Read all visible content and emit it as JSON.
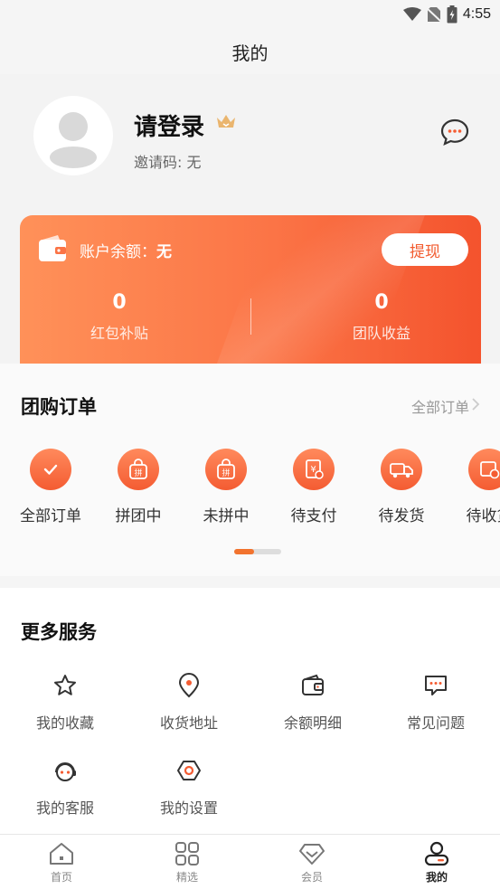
{
  "status_bar": {
    "time": "4:55"
  },
  "header": {
    "title": "我的"
  },
  "profile": {
    "name": "请登录",
    "invite_label": "邀请码: 无"
  },
  "balance": {
    "label": "账户余额：",
    "value": "无",
    "withdraw_label": "提现",
    "stats": [
      {
        "value": "0",
        "label": "红包补贴"
      },
      {
        "value": "0",
        "label": "团队收益"
      }
    ]
  },
  "orders": {
    "title": "团购订单",
    "all_label": "全部订单",
    "items": [
      {
        "label": "全部订单",
        "icon": "check-icon"
      },
      {
        "label": "拼团中",
        "icon": "group-bag-icon"
      },
      {
        "label": "未拼中",
        "icon": "group-bag-icon"
      },
      {
        "label": "待支付",
        "icon": "payment-icon"
      },
      {
        "label": "待发货",
        "icon": "truck-icon"
      },
      {
        "label": "待收货",
        "icon": "receive-icon"
      }
    ],
    "scroll_position": 0.0
  },
  "services": {
    "title": "更多服务",
    "items": [
      {
        "label": "我的收藏",
        "icon": "star-icon"
      },
      {
        "label": "收货地址",
        "icon": "location-icon"
      },
      {
        "label": "余额明细",
        "icon": "wallet-icon"
      },
      {
        "label": "常见问题",
        "icon": "chat-icon"
      },
      {
        "label": "我的客服",
        "icon": "headset-icon"
      },
      {
        "label": "我的设置",
        "icon": "settings-icon"
      }
    ]
  },
  "tabbar": {
    "items": [
      {
        "label": "首页",
        "icon": "home-icon",
        "active": false
      },
      {
        "label": "精选",
        "icon": "grid-icon",
        "active": false
      },
      {
        "label": "会员",
        "icon": "diamond-icon",
        "active": false
      },
      {
        "label": "我的",
        "icon": "user-icon",
        "active": true
      }
    ]
  },
  "colors": {
    "accent": "#f45c32",
    "accent_light": "#ff9159"
  }
}
